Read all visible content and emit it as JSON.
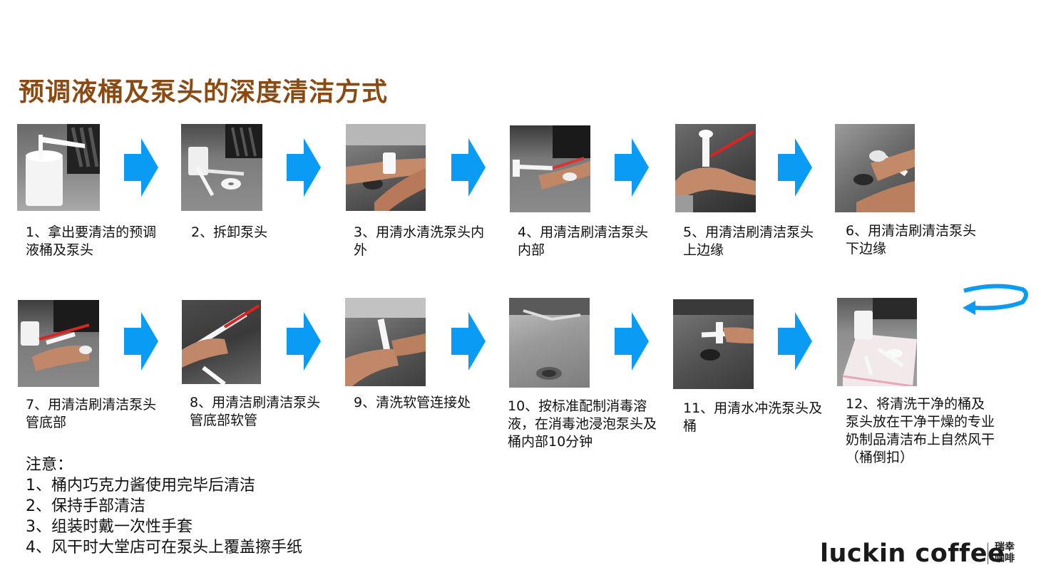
{
  "title": "预调液桶及泵头的深度清洁方式",
  "steps": [
    {
      "caption": "1、拿出要清洁的预调液桶及泵头"
    },
    {
      "caption": "2、拆卸泵头"
    },
    {
      "caption": "3、用清水清洗泵头内外"
    },
    {
      "caption": "4、用清洁刷清洁泵头内部"
    },
    {
      "caption": "5、用清洁刷清洁泵头上边缘"
    },
    {
      "caption": "6、用清洁刷清洁泵头下边缘"
    },
    {
      "caption": "7、用清洁刷清洁泵头管底部"
    },
    {
      "caption": "8、用清洁刷清洁泵头管底部软管"
    },
    {
      "caption": "9、清洗软管连接处"
    },
    {
      "caption": "10、按标准配制消毒溶液，在消毒池浸泡泵头及桶内部10分钟"
    },
    {
      "caption": "11、用清水冲洗泵头及桶"
    },
    {
      "caption": "12、将清洗干净的桶及泵头放在干净干燥的专业奶制品清洁布上自然风干（桶倒扣）"
    }
  ],
  "notes": {
    "heading": "注意：",
    "items": [
      "1、桶内巧克力酱使用完毕后清洁",
      "2、保持手部清洁",
      "3、组装时戴一次性手套",
      "4、风干时大堂店可在泵头上覆盖擦手纸"
    ]
  },
  "logo": {
    "main": "luckin coffee",
    "cn": "瑞幸咖啡"
  },
  "colors": {
    "title": "#8B4A12",
    "arrow": "#0a9cf5"
  }
}
